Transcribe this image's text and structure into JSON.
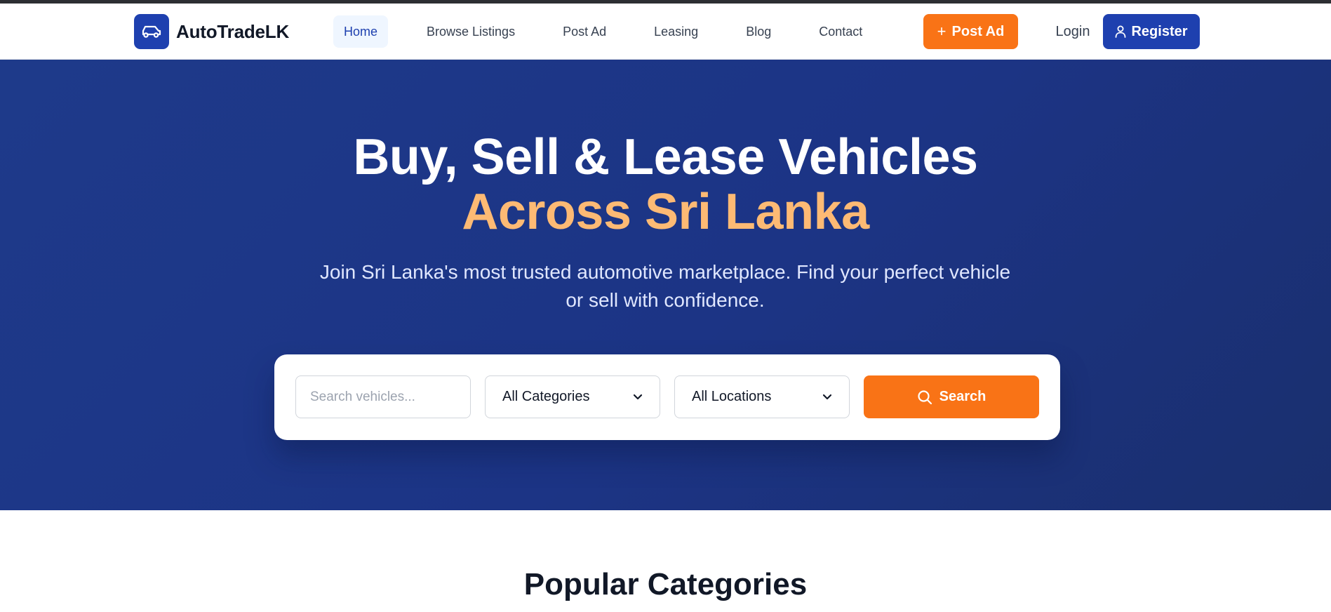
{
  "brand": {
    "name": "AutoTradeLK",
    "logo_icon": "car-icon"
  },
  "nav": {
    "links": [
      {
        "label": "Home",
        "active": true
      },
      {
        "label": "Browse Listings",
        "active": false
      },
      {
        "label": "Post Ad",
        "active": false
      },
      {
        "label": "Leasing",
        "active": false
      },
      {
        "label": "Blog",
        "active": false
      },
      {
        "label": "Contact",
        "active": false
      }
    ],
    "post_ad_label": "Post Ad",
    "login_label": "Login",
    "register_label": "Register"
  },
  "hero": {
    "title_line1": "Buy, Sell & Lease Vehicles",
    "title_line2": "Across Sri Lanka",
    "subtitle": "Join Sri Lanka's most trusted automotive marketplace. Find your perfect vehicle or sell with confidence."
  },
  "search": {
    "placeholder": "Search vehicles...",
    "value": "",
    "category_selected": "All Categories",
    "location_selected": "All Locations",
    "button_label": "Search"
  },
  "sections": {
    "popular_title": "Popular Categories"
  },
  "colors": {
    "brand_blue": "#1e40af",
    "accent_orange": "#f97316",
    "hero_bg": "#1e3a8a",
    "hero_accent_text": "#fdba74"
  }
}
